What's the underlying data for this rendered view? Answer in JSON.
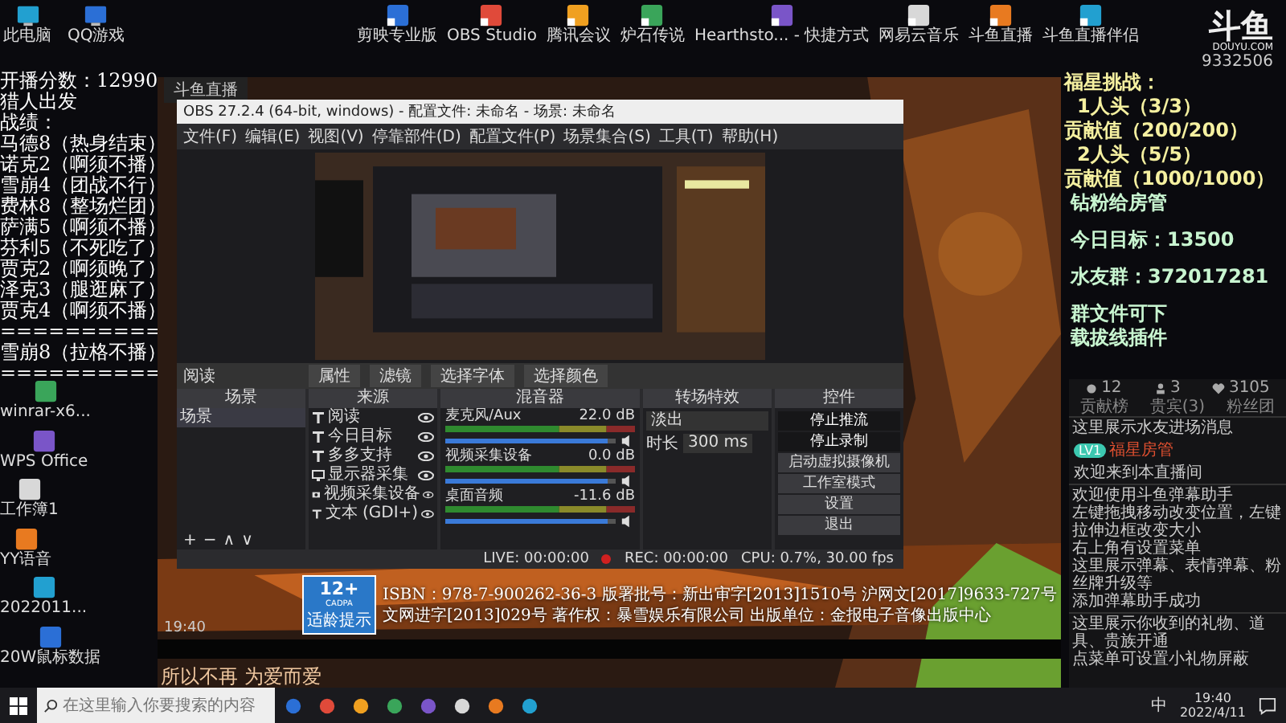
{
  "desktop_icons_corner": [
    {
      "label": "此电脑"
    },
    {
      "label": "QQ游戏"
    }
  ],
  "desktop_icons_row": [
    {
      "label": "剪映专业版"
    },
    {
      "label": "OBS Studio"
    },
    {
      "label": "腾讯会议"
    },
    {
      "label": "炉石传说"
    },
    {
      "label": "Hearthsto... - 快捷方式"
    },
    {
      "label": "网易云音乐"
    },
    {
      "label": "斗鱼直播"
    },
    {
      "label": "斗鱼直播伴侣"
    }
  ],
  "desktop_icons_left": [
    {
      "label": "winrar-x6..."
    },
    {
      "label": "WPS Office"
    },
    {
      "label": "工作簿1"
    },
    {
      "label": "YY语音"
    },
    {
      "label": "2022011..."
    },
    {
      "label": "20W鼠标数据"
    }
  ],
  "left_overlay": [
    "开播分数：12990",
    "猎人出发",
    "战绩：",
    "马德8（热身结束）",
    "诺克2（啊须不播）",
    "雪崩4（团战不行）",
    "费林8（整场烂团）",
    "萨满5（啊须不播）",
    "芬利5（不死吃了）",
    "贾克2（啊须晚了）",
    "泽克3（腿逛麻了）",
    "贾克4（啊须不播）",
    "==========",
    "雪崩8（拉格不播）",
    "=========="
  ],
  "stream_window": {
    "title": "斗鱼直播",
    "clock": "19:40",
    "isbn": [
      "ISBN：978-7-900262-36-3 版署批号：新出审字[2013]1510号 沪网文[2017]9633-727号",
      "文网进字[2013]029号 著作权：暴雪娱乐有限公司 出版单位：金报电子音像出版中心"
    ],
    "age_badge": {
      "rating": "12+",
      "org": "CADPA",
      "caption": "适龄提示"
    },
    "lyric": "所以不再 为爱而爱"
  },
  "obs": {
    "title": "OBS 27.2.4 (64-bit, windows) - 配置文件: 未命名 - 场景: 未命名",
    "menu": [
      "文件(F)",
      "编辑(E)",
      "视图(V)",
      "停靠部件(D)",
      "配置文件(P)",
      "场景集合(S)",
      "工具(T)",
      "帮助(H)"
    ],
    "source_label": "阅读",
    "toolbar": [
      "属性",
      "滤镜",
      "选择字体",
      "选择颜色"
    ],
    "docks": [
      "场景",
      "来源",
      "混音器",
      "转场特效",
      "控件"
    ],
    "scenes": [
      {
        "name": "场景",
        "selected": true
      }
    ],
    "scene_buttons": [
      "+",
      "−",
      "∧",
      "∨"
    ],
    "sources": [
      {
        "name": "阅读",
        "kind": "text"
      },
      {
        "name": "今日目标",
        "kind": "text"
      },
      {
        "name": "多多支持",
        "kind": "text"
      },
      {
        "name": "显示器采集",
        "kind": "monitor"
      },
      {
        "name": "视频采集设备",
        "kind": "camera"
      },
      {
        "name": "文本 (GDI+)",
        "kind": "text"
      }
    ],
    "mixer": [
      {
        "name": "麦克风/Aux",
        "reading": "22.0 dB",
        "level": 0.95
      },
      {
        "name": "视频采集设备",
        "reading": "0.0 dB",
        "level": 0.95
      },
      {
        "name": "桌面音频",
        "reading": "-11.6 dB",
        "level": 0.95
      }
    ],
    "transition": {
      "value": "淡出",
      "duration_label": "时长",
      "duration": "300 ms"
    },
    "controls": [
      {
        "label": "停止推流",
        "active": true
      },
      {
        "label": "停止录制",
        "active": true
      },
      {
        "label": "启动虚拟摄像机",
        "active": false
      },
      {
        "label": "工作室模式",
        "active": false
      },
      {
        "label": "设置",
        "active": false
      },
      {
        "label": "退出",
        "active": false
      }
    ],
    "status": {
      "live": "LIVE: 00:00:00",
      "rec": "REC: 00:00:00",
      "cpu": "CPU: 0.7%, 30.00 fps"
    }
  },
  "right_overlay": {
    "logo": "斗鱼",
    "logo_sub": "DOUYU.COM",
    "room": "9332506",
    "challenge": [
      "福星挑战：",
      "1人头（3/3）",
      "贡献值（200/200）",
      "2人头（5/5）",
      "贡献值（1000/1000）"
    ],
    "notes": [
      "钻粉给房管",
      "今日目标：13500",
      "水友群：372017281",
      "群文件可下",
      "载拔线插件"
    ]
  },
  "chat": {
    "stats": [
      {
        "kind": "fans",
        "value": "12"
      },
      {
        "kind": "vip",
        "value": "3"
      },
      {
        "kind": "heat",
        "value": "3105"
      }
    ],
    "tabs": [
      {
        "label": "贡献榜",
        "selected": false
      },
      {
        "label": "贵宾(3)",
        "selected": false
      },
      {
        "label": "粉丝团",
        "selected": false
      }
    ],
    "entry_notice": "这里展示水友进场消息",
    "welcome": {
      "badge": "LV1",
      "user": "福星房管",
      "text": "欢迎来到本直播间"
    },
    "messages": [
      "欢迎使用斗鱼弹幕助手",
      "左键拖拽移动改变位置，左键拉伸边框改变大小",
      "右上角有设置菜单",
      "这里展示弹幕、表情弹幕、粉丝牌升级等",
      "添加弹幕助手成功"
    ],
    "gift_notice": [
      "这里展示你收到的礼物、道具、贵族开通",
      "点菜单可设置小礼物屏蔽"
    ]
  },
  "taskbar": {
    "search": {
      "placeholder": "在这里输入你要搜索的内容"
    },
    "ime": "中",
    "time": "19:40",
    "date": "2022/4/11"
  }
}
